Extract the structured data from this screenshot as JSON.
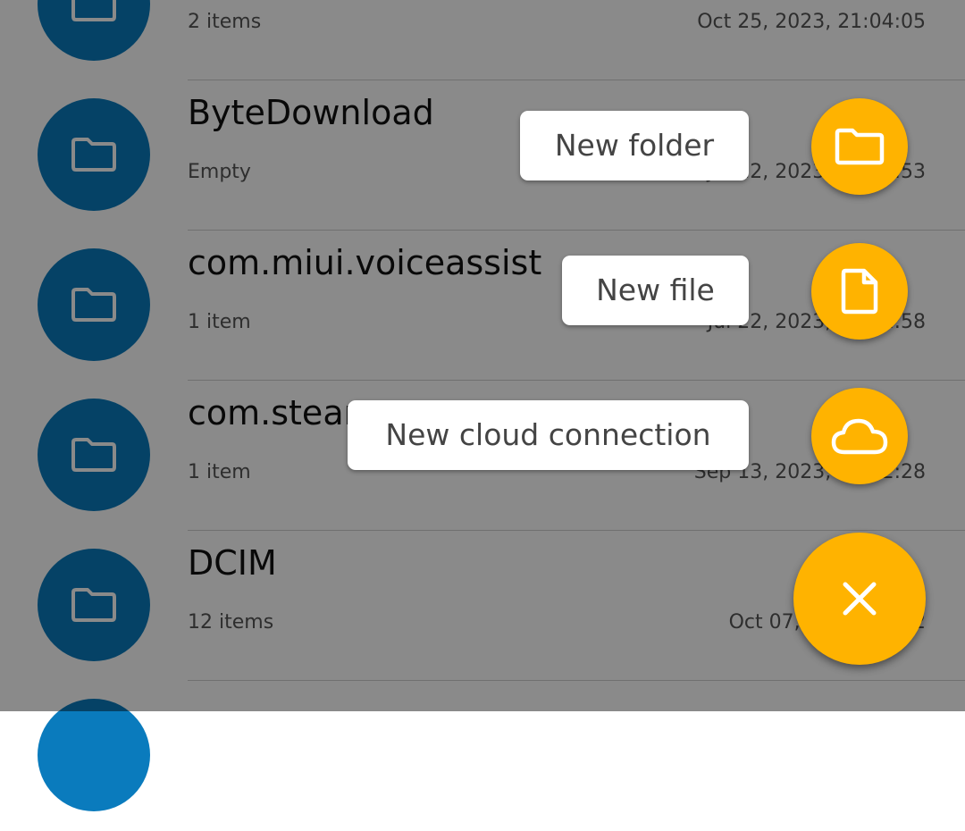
{
  "colors": {
    "folder_circle": "#0a7bbd",
    "fab": "#ffb300",
    "scrim": "rgba(0,0,0,0.46)"
  },
  "files": [
    {
      "title": "",
      "subtitle": "2 items",
      "date": "Oct 25, 2023, 21:04:05",
      "icon": "folder-icon"
    },
    {
      "title": "ByteDownload",
      "subtitle": "Empty",
      "date": "Jul 22, 2023, 18:15:53",
      "icon": "folder-icon"
    },
    {
      "title": "com.miui.voiceassist",
      "subtitle": "1 item",
      "date": "Jul 22, 2023, 19:01:58",
      "icon": "folder-icon"
    },
    {
      "title": "com.stear",
      "subtitle": "1 item",
      "date": "Sep 13, 2023, 08:52:28",
      "icon": "folder-icon"
    },
    {
      "title": "DCIM",
      "subtitle": "12 items",
      "date": "Oct 07, 2023, 18:42",
      "icon": "folder-icon"
    },
    {
      "title": "",
      "subtitle": "",
      "date": "",
      "icon": "folder-icon"
    }
  ],
  "fab_menu": {
    "new_folder": {
      "label": "New folder",
      "icon": "folder-icon"
    },
    "new_file": {
      "label": "New file",
      "icon": "file-icon"
    },
    "new_cloud": {
      "label": "New cloud connection",
      "icon": "cloud-icon"
    },
    "close_icon": "close-icon"
  }
}
